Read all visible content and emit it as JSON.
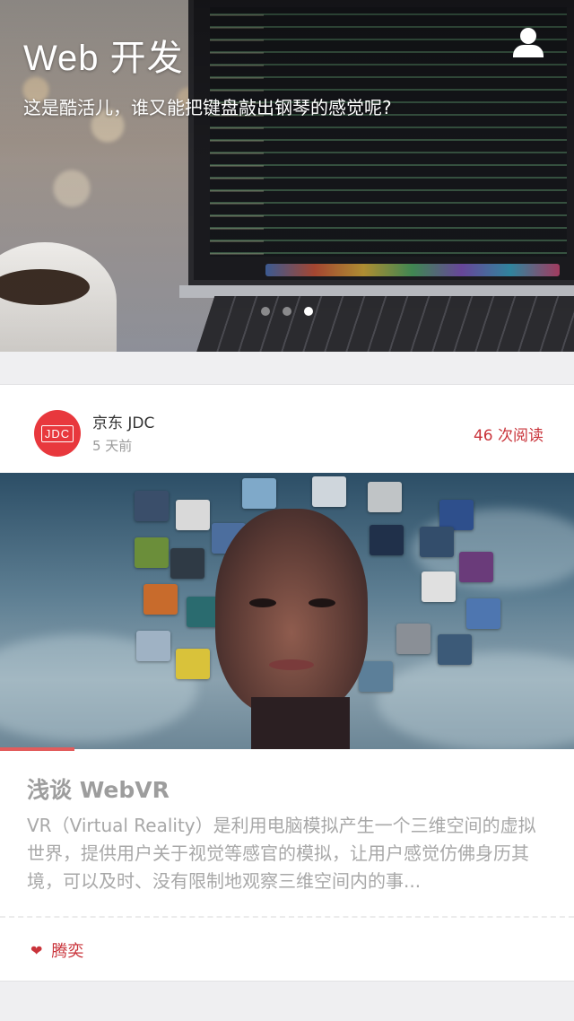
{
  "hero": {
    "title": "Web 开发",
    "subtitle": "这是酷活儿，谁又能把键盘敲出钢琴的感觉呢?",
    "user_icon": "user-icon",
    "carousel": {
      "count": 3,
      "active_index": 2
    }
  },
  "card": {
    "author": {
      "avatar_text": "JDC",
      "name": "京东 JDC",
      "time": "5 天前"
    },
    "reads": "46 次阅读",
    "cover_progress": 0.13,
    "title": "浅谈 WebVR",
    "excerpt": "VR（Virtual Reality）是利用电脑模拟产生一个三维空间的虚拟世界，提供用户关于视觉等感官的模拟，让用户感觉仿佛身历其境，可以及时、没有限制地观察三维空间内的事...",
    "tag": {
      "icon": "heart-icon",
      "label": "腾奕"
    },
    "colors": {
      "accent": "#c9333a",
      "brand": "#e8383d"
    }
  }
}
